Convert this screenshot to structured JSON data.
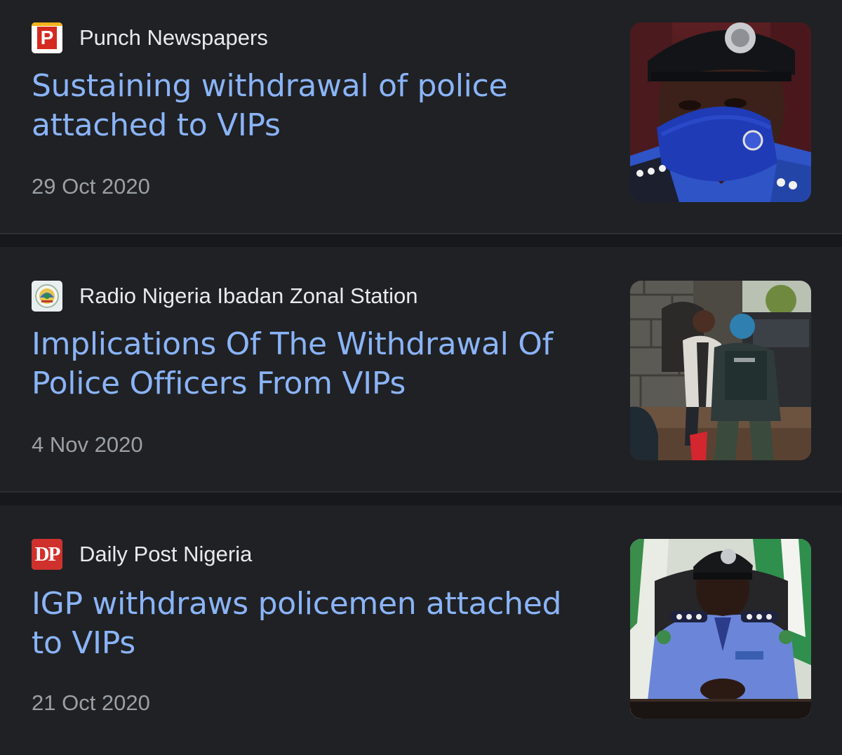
{
  "articles": [
    {
      "source": "Punch Newspapers",
      "favicon": "punch-logo-icon",
      "headline": "Sustaining withdrawal of police attached to VIPs",
      "date": "29 Oct 2020",
      "thumbnail": "masked-police-officer-photo"
    },
    {
      "source": "Radio Nigeria Ibadan Zonal Station",
      "favicon": "radio-nigeria-seal-icon",
      "headline": "Implications Of The Withdrawal Of Police Officers From VIPs",
      "date": "4 Nov 2020",
      "thumbnail": "police-escort-vip-photo"
    },
    {
      "source": "Daily Post Nigeria",
      "favicon": "daily-post-logo-icon",
      "favicon_text": "DP",
      "headline": "IGP withdraws policemen attached to VIPs",
      "date": "21 Oct 2020",
      "thumbnail": "igp-at-desk-photo"
    }
  ],
  "colors": {
    "background": "#202124",
    "headline": "#8ab4f8",
    "source_text": "#e8eaed",
    "date_text": "#9aa0a6",
    "separator": "#17181b"
  }
}
